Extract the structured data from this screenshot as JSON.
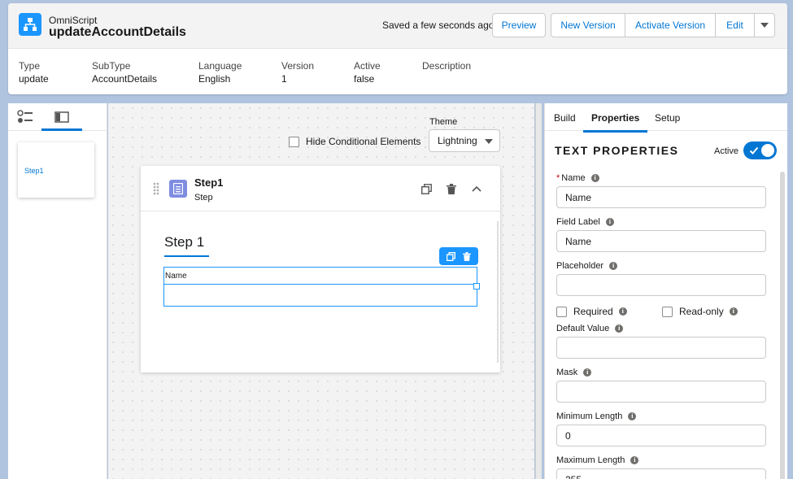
{
  "header": {
    "app_type": "OmniScript",
    "app_name": "updateAccountDetails",
    "saved_status": "Saved a few seconds ago",
    "buttons": {
      "preview": "Preview",
      "new_version": "New Version",
      "activate_version": "Activate Version",
      "edit": "Edit"
    },
    "meta": [
      {
        "label": "Type",
        "value": "update"
      },
      {
        "label": "SubType",
        "value": "AccountDetails"
      },
      {
        "label": "Language",
        "value": "English"
      },
      {
        "label": "Version",
        "value": "1"
      },
      {
        "label": "Active",
        "value": "false"
      },
      {
        "label": "Description",
        "value": ""
      }
    ]
  },
  "left_panel": {
    "step_thumb_label": "Step1"
  },
  "canvas": {
    "hide_conditional_label": "Hide Conditional Elements",
    "theme_label": "Theme",
    "theme_value": "Lightning",
    "step": {
      "title": "Step1",
      "subtitle": "Step",
      "heading": "Step 1",
      "element_label": "Name"
    }
  },
  "right_panel": {
    "tabs": [
      "Build",
      "Properties",
      "Setup"
    ],
    "active_tab": "Properties",
    "heading": "TEXT PROPERTIES",
    "active_label": "Active",
    "active_on": true,
    "fields": {
      "name_label": "Name",
      "name_value": "Name",
      "field_label_label": "Field Label",
      "field_label_value": "Name",
      "placeholder_label": "Placeholder",
      "placeholder_value": "",
      "required_label": "Required",
      "readonly_label": "Read-only",
      "default_value_label": "Default Value",
      "default_value_value": "",
      "mask_label": "Mask",
      "mask_value": "",
      "min_length_label": "Minimum Length",
      "min_length_value": "0",
      "max_length_label": "Maximum Length",
      "max_length_value": "255"
    }
  },
  "colors": {
    "brand": "#0176d3",
    "accent": "#1b96ff",
    "step_icon": "#7f8de1",
    "background": "#b0c4df"
  },
  "icons": [
    "omniscript-icon",
    "list-view-icon",
    "panel-view-icon",
    "drag-handle-icon",
    "step-icon",
    "clone-icon",
    "delete-icon",
    "chevron-up-icon",
    "chevron-down-icon",
    "info-icon",
    "checkmark-icon"
  ]
}
